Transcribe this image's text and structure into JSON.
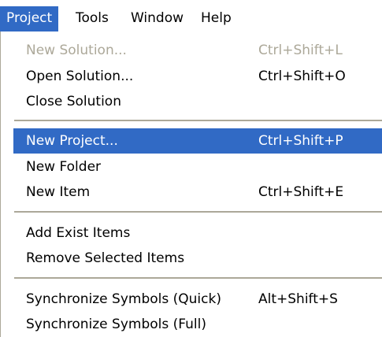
{
  "menubar": {
    "items": [
      {
        "label": "Project"
      },
      {
        "label": "Tools"
      },
      {
        "label": "Window"
      },
      {
        "label": "Help"
      }
    ]
  },
  "menu": {
    "items": [
      {
        "label": "New Solution...",
        "shortcut": "Ctrl+Shift+L",
        "enabled": false
      },
      {
        "label": "Open Solution...",
        "shortcut": "Ctrl+Shift+O",
        "enabled": true
      },
      {
        "label": "Close Solution",
        "shortcut": "",
        "enabled": true
      },
      {
        "label": "New Project...",
        "shortcut": "Ctrl+Shift+P",
        "enabled": true,
        "highlighted": true
      },
      {
        "label": "New Folder",
        "shortcut": "",
        "enabled": true
      },
      {
        "label": "New Item",
        "shortcut": "Ctrl+Shift+E",
        "enabled": true
      },
      {
        "label": "Add Exist Items",
        "shortcut": "",
        "enabled": true
      },
      {
        "label": "Remove Selected Items",
        "shortcut": "",
        "enabled": true
      },
      {
        "label": "Synchronize Symbols (Quick)",
        "shortcut": "Alt+Shift+S",
        "enabled": true
      },
      {
        "label": "Synchronize Symbols (Full)",
        "shortcut": "",
        "enabled": true
      }
    ]
  },
  "colors": {
    "highlight": "#316ac5",
    "highlight_text": "#ffffff",
    "disabled_text": "#aca899",
    "separator": "#aca899"
  }
}
